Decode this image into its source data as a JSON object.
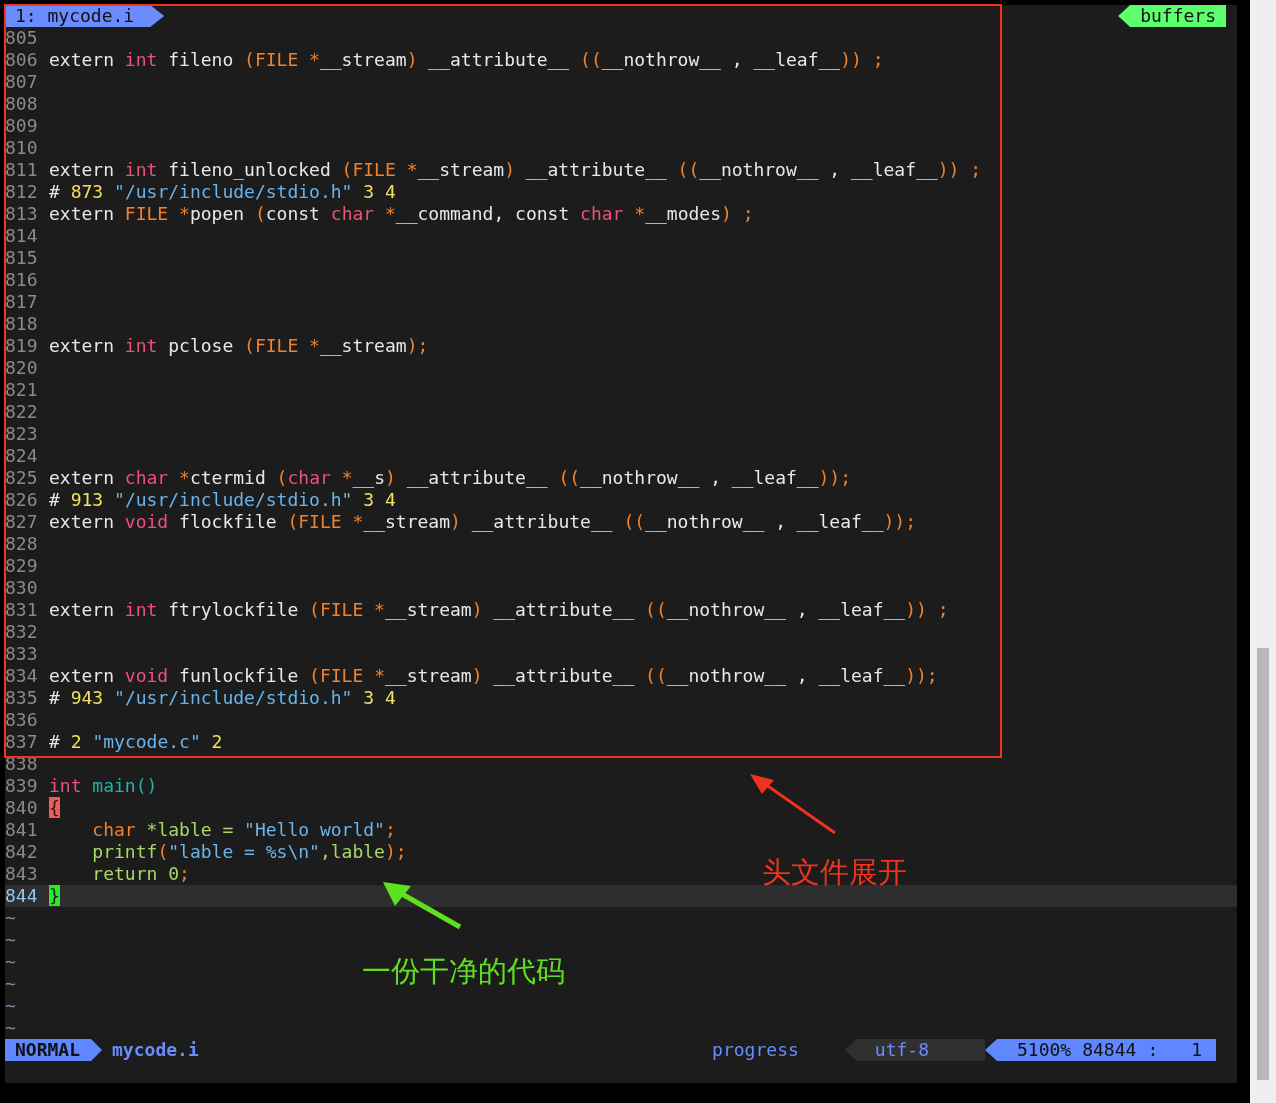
{
  "tabline": {
    "buffer": "1: mycode.i",
    "label": "buffers"
  },
  "lines": [
    {
      "number": "805",
      "current": false
    },
    {
      "number": "806",
      "current": false,
      "tokens": [
        {
          "kind": "plain",
          "text": "extern "
        },
        {
          "kind": "type",
          "text": "int"
        },
        {
          "kind": "plain",
          "text": " fileno "
        },
        {
          "kind": "punct",
          "text": "(FILE *"
        },
        {
          "kind": "plain",
          "text": "__stream"
        },
        {
          "kind": "punct",
          "text": ")"
        },
        {
          "kind": "plain",
          "text": " __attribute__ "
        },
        {
          "kind": "punct",
          "text": "(("
        },
        {
          "kind": "plain",
          "text": "__nothrow__ , __leaf__"
        },
        {
          "kind": "punct",
          "text": ")) ;"
        }
      ]
    },
    {
      "number": "807",
      "current": false
    },
    {
      "number": "808",
      "current": false
    },
    {
      "number": "809",
      "current": false
    },
    {
      "number": "810",
      "current": false
    },
    {
      "number": "811",
      "current": false,
      "tokens": [
        {
          "kind": "plain",
          "text": "extern "
        },
        {
          "kind": "type",
          "text": "int"
        },
        {
          "kind": "plain",
          "text": " fileno_unlocked "
        },
        {
          "kind": "punct",
          "text": "(FILE *"
        },
        {
          "kind": "plain",
          "text": "__stream"
        },
        {
          "kind": "punct",
          "text": ")"
        },
        {
          "kind": "plain",
          "text": " __attribute__ "
        },
        {
          "kind": "punct",
          "text": "(("
        },
        {
          "kind": "plain",
          "text": "__nothrow__ , __leaf__"
        },
        {
          "kind": "punct",
          "text": ")) ;"
        }
      ]
    },
    {
      "number": "812",
      "current": false,
      "tokens": [
        {
          "kind": "plain",
          "text": "# "
        },
        {
          "kind": "number",
          "text": "873 "
        },
        {
          "kind": "string",
          "text": "\"/usr/include/stdio.h\" "
        },
        {
          "kind": "number",
          "text": "3 4"
        }
      ]
    },
    {
      "number": "813",
      "current": false,
      "tokens": [
        {
          "kind": "plain",
          "text": "extern "
        },
        {
          "kind": "punct",
          "text": "FILE *"
        },
        {
          "kind": "plain",
          "text": "popen "
        },
        {
          "kind": "punct",
          "text": "("
        },
        {
          "kind": "plain",
          "text": "const "
        },
        {
          "kind": "type",
          "text": "char"
        },
        {
          "kind": "punct",
          "text": " *"
        },
        {
          "kind": "plain",
          "text": "__command, const "
        },
        {
          "kind": "type",
          "text": "char"
        },
        {
          "kind": "punct",
          "text": " *"
        },
        {
          "kind": "plain",
          "text": "__modes"
        },
        {
          "kind": "punct",
          "text": ") ;"
        }
      ]
    },
    {
      "number": "814",
      "current": false
    },
    {
      "number": "815",
      "current": false
    },
    {
      "number": "816",
      "current": false
    },
    {
      "number": "817",
      "current": false
    },
    {
      "number": "818",
      "current": false
    },
    {
      "number": "819",
      "current": false,
      "tokens": [
        {
          "kind": "plain",
          "text": "extern "
        },
        {
          "kind": "type",
          "text": "int"
        },
        {
          "kind": "plain",
          "text": " pclose "
        },
        {
          "kind": "punct",
          "text": "(FILE *"
        },
        {
          "kind": "plain",
          "text": "__stream"
        },
        {
          "kind": "punct",
          "text": ");"
        }
      ]
    },
    {
      "number": "820",
      "current": false
    },
    {
      "number": "821",
      "current": false
    },
    {
      "number": "822",
      "current": false
    },
    {
      "number": "823",
      "current": false
    },
    {
      "number": "824",
      "current": false
    },
    {
      "number": "825",
      "current": false,
      "tokens": [
        {
          "kind": "plain",
          "text": "extern "
        },
        {
          "kind": "type",
          "text": "char"
        },
        {
          "kind": "punct",
          "text": " *"
        },
        {
          "kind": "plain",
          "text": "ctermid "
        },
        {
          "kind": "punct",
          "text": "("
        },
        {
          "kind": "type",
          "text": "char"
        },
        {
          "kind": "punct",
          "text": " *"
        },
        {
          "kind": "plain",
          "text": "__s"
        },
        {
          "kind": "punct",
          "text": ")"
        },
        {
          "kind": "plain",
          "text": " __attribute__ "
        },
        {
          "kind": "punct",
          "text": "(("
        },
        {
          "kind": "plain",
          "text": "__nothrow__ , __leaf__"
        },
        {
          "kind": "punct",
          "text": "));"
        }
      ]
    },
    {
      "number": "826",
      "current": false,
      "tokens": [
        {
          "kind": "plain",
          "text": "# "
        },
        {
          "kind": "number",
          "text": "913 "
        },
        {
          "kind": "string",
          "text": "\"/usr/include/stdio.h\" "
        },
        {
          "kind": "number",
          "text": "3 4"
        }
      ]
    },
    {
      "number": "827",
      "current": false,
      "tokens": [
        {
          "kind": "plain",
          "text": "extern "
        },
        {
          "kind": "type",
          "text": "void"
        },
        {
          "kind": "plain",
          "text": " flockfile "
        },
        {
          "kind": "punct",
          "text": "(FILE *"
        },
        {
          "kind": "plain",
          "text": "__stream"
        },
        {
          "kind": "punct",
          "text": ")"
        },
        {
          "kind": "plain",
          "text": " __attribute__ "
        },
        {
          "kind": "punct",
          "text": "(("
        },
        {
          "kind": "plain",
          "text": "__nothrow__ , __leaf__"
        },
        {
          "kind": "punct",
          "text": "));"
        }
      ]
    },
    {
      "number": "828",
      "current": false
    },
    {
      "number": "829",
      "current": false
    },
    {
      "number": "830",
      "current": false
    },
    {
      "number": "831",
      "current": false,
      "tokens": [
        {
          "kind": "plain",
          "text": "extern "
        },
        {
          "kind": "type",
          "text": "int"
        },
        {
          "kind": "plain",
          "text": " ftrylockfile "
        },
        {
          "kind": "punct",
          "text": "(FILE *"
        },
        {
          "kind": "plain",
          "text": "__stream"
        },
        {
          "kind": "punct",
          "text": ")"
        },
        {
          "kind": "plain",
          "text": " __attribute__ "
        },
        {
          "kind": "punct",
          "text": "(("
        },
        {
          "kind": "plain",
          "text": "__nothrow__ , __leaf__"
        },
        {
          "kind": "punct",
          "text": ")) ;"
        }
      ]
    },
    {
      "number": "832",
      "current": false
    },
    {
      "number": "833",
      "current": false
    },
    {
      "number": "834",
      "current": false,
      "tokens": [
        {
          "kind": "plain",
          "text": "extern "
        },
        {
          "kind": "type",
          "text": "void"
        },
        {
          "kind": "plain",
          "text": " funlockfile "
        },
        {
          "kind": "punct",
          "text": "(FILE *"
        },
        {
          "kind": "plain",
          "text": "__stream"
        },
        {
          "kind": "punct",
          "text": ")"
        },
        {
          "kind": "plain",
          "text": " __attribute__ "
        },
        {
          "kind": "punct",
          "text": "(("
        },
        {
          "kind": "plain",
          "text": "__nothrow__ , __leaf__"
        },
        {
          "kind": "punct",
          "text": "));"
        }
      ]
    },
    {
      "number": "835",
      "current": false,
      "tokens": [
        {
          "kind": "plain",
          "text": "# "
        },
        {
          "kind": "number",
          "text": "943 "
        },
        {
          "kind": "string",
          "text": "\"/usr/include/stdio.h\" "
        },
        {
          "kind": "number",
          "text": "3 4"
        }
      ]
    },
    {
      "number": "836",
      "current": false
    },
    {
      "number": "837",
      "current": false,
      "tokens": [
        {
          "kind": "plain",
          "text": "# "
        },
        {
          "kind": "number",
          "text": "2 "
        },
        {
          "kind": "string",
          "text": "\"mycode.c\" "
        },
        {
          "kind": "number",
          "text": "2"
        }
      ]
    },
    {
      "number": "838",
      "current": false
    },
    {
      "number": "839",
      "current": false,
      "tokens": [
        {
          "kind": "type",
          "text": "int "
        },
        {
          "kind": "func",
          "text": "main()"
        }
      ]
    },
    {
      "number": "840",
      "current": false,
      "tokens": [
        {
          "kind": "brace",
          "text": "{"
        }
      ]
    },
    {
      "number": "841",
      "current": false,
      "tokens": [
        {
          "kind": "punct",
          "text": "    char"
        },
        {
          "kind": "green",
          "text": " *lable = "
        },
        {
          "kind": "string",
          "text": "\"Hello world\""
        },
        {
          "kind": "punct",
          "text": ";"
        }
      ]
    },
    {
      "number": "842",
      "current": false,
      "tokens": [
        {
          "kind": "green",
          "text": "    printf"
        },
        {
          "kind": "punct",
          "text": "("
        },
        {
          "kind": "string",
          "text": "\"lable = %s\\n\""
        },
        {
          "kind": "green",
          "text": ",lable"
        },
        {
          "kind": "punct",
          "text": ");"
        }
      ]
    },
    {
      "number": "843",
      "current": false,
      "tokens": [
        {
          "kind": "green",
          "text": "    return 0"
        },
        {
          "kind": "punct",
          "text": ";"
        }
      ]
    },
    {
      "number": "844",
      "current": true,
      "tokens": [
        {
          "kind": "cursor",
          "text": "}"
        }
      ]
    }
  ],
  "tildes": [
    "~",
    "~",
    "~",
    "~",
    "~",
    "~"
  ],
  "status_bar": {
    "mode": "NORMAL",
    "file": "mycode.i",
    "progress": "progress",
    "encoding": "utf-8",
    "percent": "5100%",
    "line": "84844",
    "separator": ":",
    "column": "1"
  },
  "annotations": [
    {
      "text": "头文件展开",
      "color": "#f0321e"
    },
    {
      "text": "一份干净的代码",
      "color": "#5ee01e"
    }
  ]
}
